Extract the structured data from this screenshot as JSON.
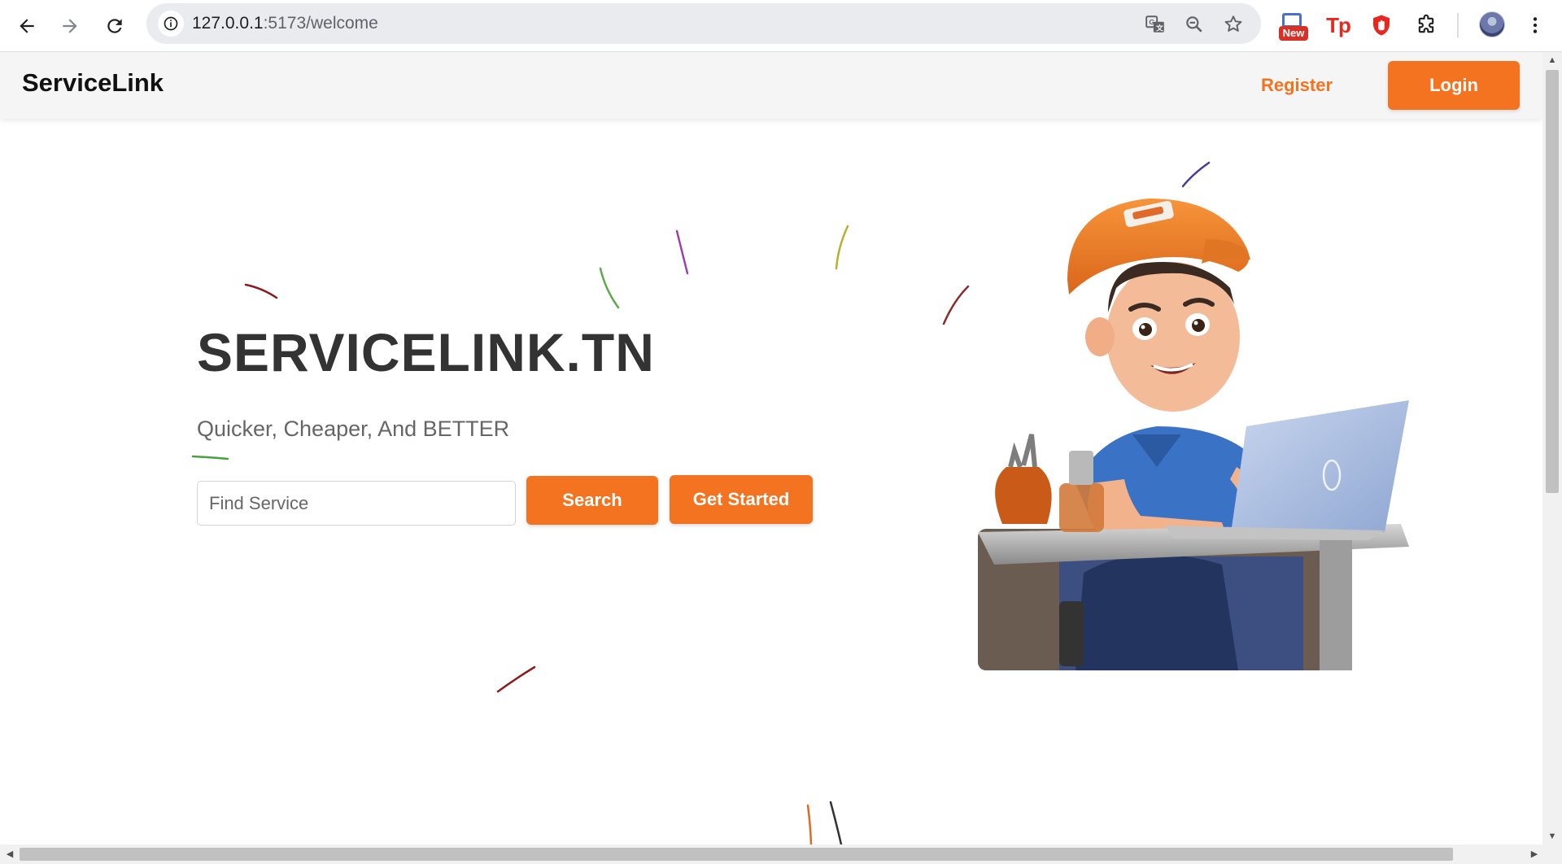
{
  "browser": {
    "url_host": "127.0.0.1",
    "url_path": ":5173/welcome",
    "extension_badge": "New",
    "extension_tp": "Tp"
  },
  "header": {
    "brand": "ServiceLink",
    "register_label": "Register",
    "login_label": "Login"
  },
  "hero": {
    "title": "SERVICELINK.TN",
    "tagline": "Quicker, Cheaper, And BETTER",
    "search_placeholder": "Find Service",
    "search_label": "Search",
    "get_started_label": "Get Started"
  },
  "colors": {
    "accent": "#f47320",
    "title_text": "#333333",
    "header_bg": "#f5f5f5"
  },
  "icons": [
    "back-arrow-icon",
    "forward-arrow-icon",
    "reload-icon",
    "site-info-icon",
    "translate-icon",
    "zoom-icon",
    "bookmark-star-icon",
    "extension-puzzle-icon",
    "kebab-menu-icon"
  ]
}
